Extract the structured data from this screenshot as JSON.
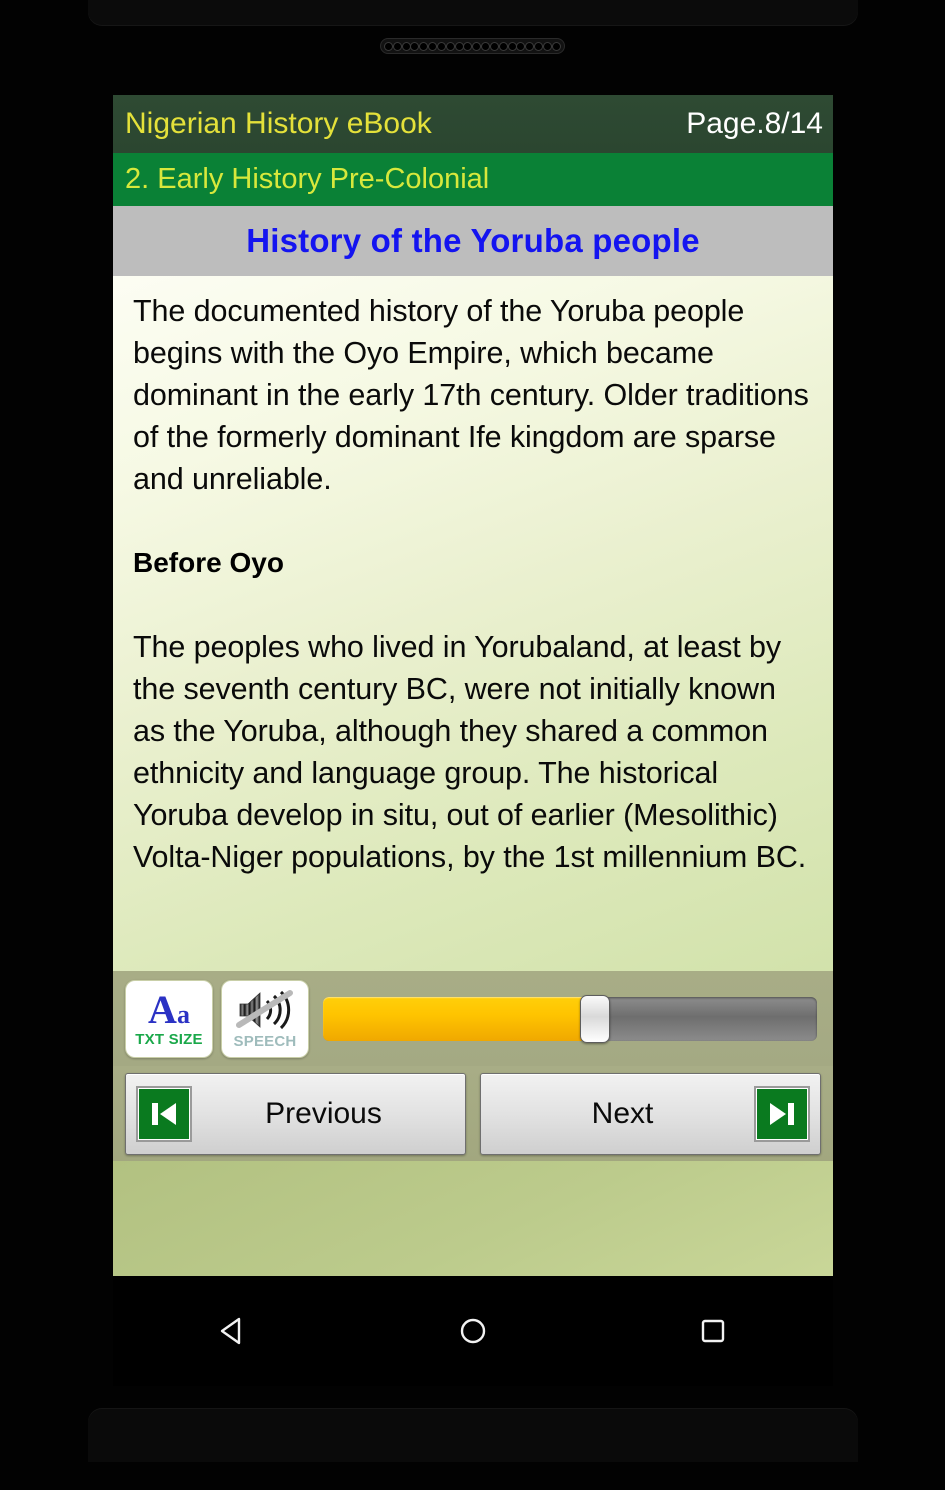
{
  "app": {
    "title": "Nigerian History eBook",
    "page_indicator": "Page.8/14",
    "chapter": "2. Early History Pre-Colonial",
    "section_title": "History of the Yoruba people"
  },
  "content": {
    "paragraph_1": "The documented history of the Yoruba people begins with the Oyo Empire, which became dominant in the early 17th century. Older traditions of the formerly dominant Ife kingdom are sparse and unreliable.",
    "heading_1": "Before Oyo",
    "paragraph_2": "The peoples who lived in Yorubaland, at least by the seventh century BC, were not initially known as the Yoruba, although they shared a common ethnicity and language group. The historical Yoruba develop in situ, out of earlier (Mesolithic) Volta-Niger populations, by the 1st millennium BC."
  },
  "toolbar": {
    "text_size": {
      "glyph_big": "A",
      "glyph_small": "a",
      "label": "TXT SIZE",
      "icon": "text-size-icon"
    },
    "speech": {
      "label": "SPEECH",
      "icon": "speaker-muted-icon",
      "muted": true
    },
    "slider": {
      "icon": "progress-slider",
      "value_percent": 55,
      "fill_color": "#ffc400",
      "track_color": "#7a7a7a"
    }
  },
  "navigation": {
    "previous": {
      "label": "Previous",
      "icon": "skip-previous-icon"
    },
    "next": {
      "label": "Next",
      "icon": "skip-next-icon"
    }
  },
  "system_nav": {
    "back": "back-triangle-icon",
    "home": "home-circle-icon",
    "recents": "recents-square-icon"
  },
  "colors": {
    "app_bar": "#2e4a33",
    "chapter_bar": "#0a8136",
    "title_yellow": "#e4e13a",
    "chapter_yellow": "#d8e83c",
    "section_blue": "#1414f0",
    "section_band": "#bdbdbd",
    "control_strip": "#a8ad86",
    "media_green": "#0a7a1f"
  }
}
